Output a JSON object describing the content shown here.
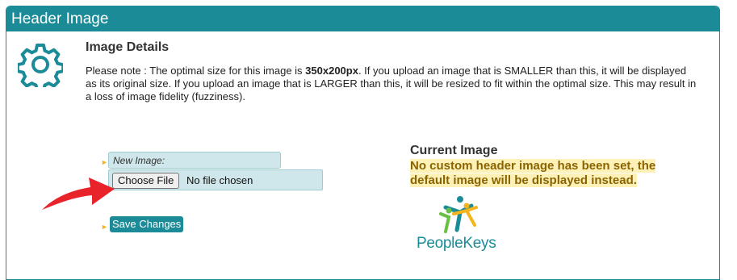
{
  "panel": {
    "title": "Header Image"
  },
  "details": {
    "title": "Image Details",
    "note_prefix": "Please note : The optimal size for this image is ",
    "note_size": "350x200px",
    "note_suffix": ". If you upload an image that is SMALLER than this, it will be displayed as its original size. If you upload an image that is LARGER than this, it will be resized to fit within the optimal size. This may result in a loss of image fidelity (fuzziness)."
  },
  "form": {
    "new_image_label": "New Image:",
    "choose_file_label": "Choose File",
    "no_file_text": "No file chosen",
    "save_label": "Save Changes"
  },
  "current": {
    "title": "Current Image",
    "message_line1": "No custom header image has been set, the",
    "message_line2": "default image will be displayed instead.",
    "logo_text": "PeopleKeys"
  },
  "colors": {
    "teal": "#1b8b98",
    "highlight": "#fdf1b8",
    "warning_text": "#8a6400",
    "arrow": "#e8232a"
  }
}
